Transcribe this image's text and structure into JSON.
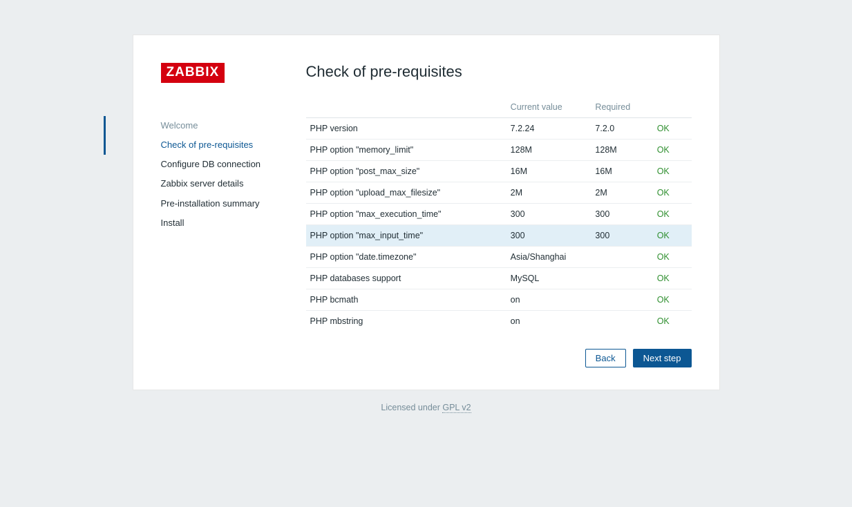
{
  "logo_text": "ZABBIX",
  "title": "Check of pre-requisites",
  "steps": [
    {
      "label": "Welcome",
      "state": "completed"
    },
    {
      "label": "Check of pre-requisites",
      "state": "active"
    },
    {
      "label": "Configure DB connection",
      "state": "upcoming"
    },
    {
      "label": "Zabbix server details",
      "state": "upcoming"
    },
    {
      "label": "Pre-installation summary",
      "state": "upcoming"
    },
    {
      "label": "Install",
      "state": "upcoming"
    }
  ],
  "columns": {
    "name": "",
    "current": "Current value",
    "required": "Required",
    "status": ""
  },
  "rows": [
    {
      "name": "PHP version",
      "current": "7.2.24",
      "required": "7.2.0",
      "status": "OK",
      "highlight": false
    },
    {
      "name": "PHP option \"memory_limit\"",
      "current": "128M",
      "required": "128M",
      "status": "OK",
      "highlight": false
    },
    {
      "name": "PHP option \"post_max_size\"",
      "current": "16M",
      "required": "16M",
      "status": "OK",
      "highlight": false
    },
    {
      "name": "PHP option \"upload_max_filesize\"",
      "current": "2M",
      "required": "2M",
      "status": "OK",
      "highlight": false
    },
    {
      "name": "PHP option \"max_execution_time\"",
      "current": "300",
      "required": "300",
      "status": "OK",
      "highlight": false
    },
    {
      "name": "PHP option \"max_input_time\"",
      "current": "300",
      "required": "300",
      "status": "OK",
      "highlight": true
    },
    {
      "name": "PHP option \"date.timezone\"",
      "current": "Asia/Shanghai",
      "required": "",
      "status": "OK",
      "highlight": false
    },
    {
      "name": "PHP databases support",
      "current": "MySQL",
      "required": "",
      "status": "OK",
      "highlight": false
    },
    {
      "name": "PHP bcmath",
      "current": "on",
      "required": "",
      "status": "OK",
      "highlight": false
    },
    {
      "name": "PHP mbstring",
      "current": "on",
      "required": "",
      "status": "OK",
      "highlight": false
    }
  ],
  "buttons": {
    "back": "Back",
    "next": "Next step"
  },
  "footer": {
    "prefix": "Licensed under ",
    "link": "GPL v2"
  }
}
